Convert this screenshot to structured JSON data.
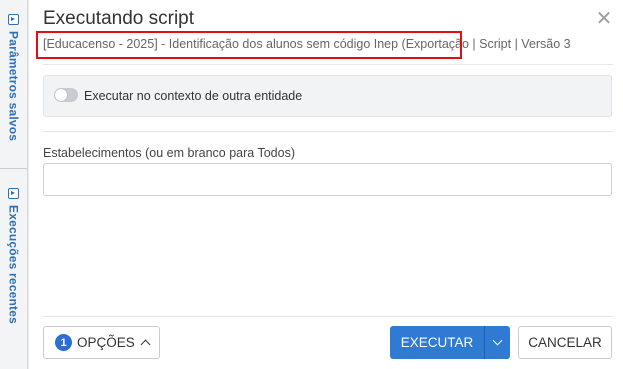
{
  "sidebar": {
    "tabs": [
      {
        "label": "Parâmetros salvos"
      },
      {
        "label": "Execuções recentes"
      }
    ]
  },
  "dialog": {
    "title": "Executando script",
    "close_icon": "close-icon",
    "subtitle": {
      "name": "[Educacenso - 2025] - Identificação dos alunos sem código Inep (Exportação",
      "meta": " | Script | Versão 3"
    },
    "highlight_color": "#e01010"
  },
  "context_toggle": {
    "label": "Executar no contexto de outra entidade",
    "on": false
  },
  "field": {
    "label": "Estabelecimentos (ou em branco para Todos)",
    "value": "",
    "placeholder": ""
  },
  "footer": {
    "options_count": "1",
    "options_label": "OPÇÕES",
    "execute_label": "EXECUTAR",
    "cancel_label": "CANCELAR",
    "primary_color": "#2f7ad3"
  }
}
